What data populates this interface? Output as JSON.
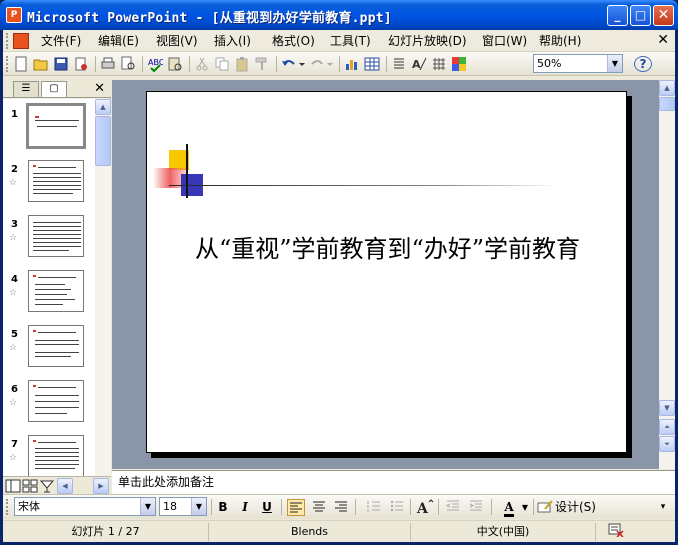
{
  "window": {
    "title": "Microsoft PowerPoint - [从重视到办好学前教育.ppt]",
    "app_icon": "P",
    "minimize": "_",
    "maximize": "□",
    "close": "✕"
  },
  "menubar": {
    "items": [
      "文件(F)",
      "编辑(E)",
      "视图(V)",
      "插入(I)",
      "格式(O)",
      "工具(T)",
      "幻灯片放映(D)",
      "窗口(W)",
      "帮助(H)"
    ],
    "close": "✕"
  },
  "standard_toolbar": {
    "zoom": "50%",
    "icons": [
      "new-icon",
      "open-icon",
      "save-icon",
      "permission-icon",
      "print-icon",
      "print-preview-icon",
      "spelling-icon",
      "research-icon",
      "cut-icon",
      "copy-icon",
      "paste-icon",
      "format-painter-icon",
      "undo-icon",
      "redo-icon",
      "insert-chart-icon",
      "insert-table-icon",
      "expand-icon",
      "show-formatting-icon",
      "grid-icon",
      "color-icon"
    ],
    "help": "?"
  },
  "left_panel": {
    "tab_outline": "☰",
    "tab_slides": "▢",
    "close": "✕",
    "slides": [
      {
        "num": "1",
        "star": ""
      },
      {
        "num": "2",
        "star": "☆"
      },
      {
        "num": "3",
        "star": "☆"
      },
      {
        "num": "4",
        "star": "☆"
      },
      {
        "num": "5",
        "star": "☆"
      },
      {
        "num": "6",
        "star": "☆"
      },
      {
        "num": "7",
        "star": "☆"
      }
    ]
  },
  "slide": {
    "title": "从“重视”学前教育到“办好”学前教育"
  },
  "notes": {
    "placeholder": "单击此处添加备注"
  },
  "format_toolbar": {
    "font": "宋体",
    "size": "18",
    "bold": "B",
    "italic": "I",
    "underline": "U",
    "font_color": "A",
    "design": "设计(S)"
  },
  "statusbar": {
    "slide_info": "幻灯片 1 / 27",
    "template": "Blends",
    "language": "中文(中国)"
  },
  "colors": {
    "title_bar": "#0054e3",
    "slide_bg": "#8a96a8",
    "deco_yellow": "#f8c800",
    "deco_red": "#e84040",
    "deco_blue": "#2c2cb4"
  }
}
